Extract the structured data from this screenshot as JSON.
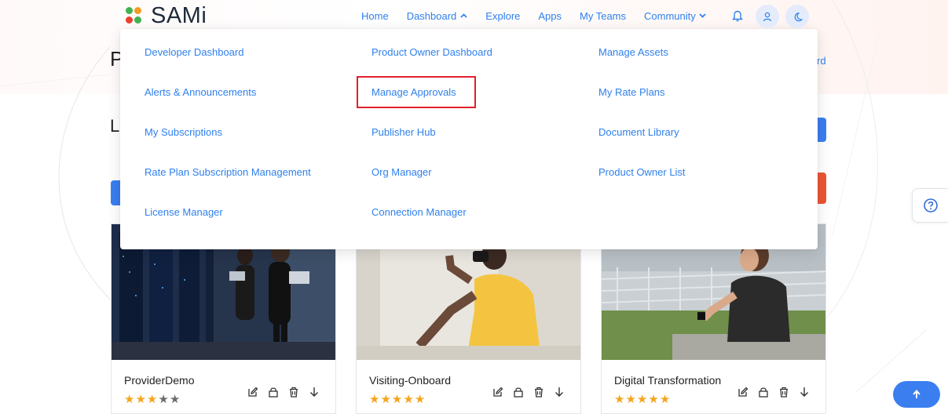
{
  "brand": {
    "name": "SAMi",
    "colors": {
      "green": "#3fb34f",
      "orange": "#f39a22",
      "red": "#e8412f",
      "blue": "#2f80ed"
    }
  },
  "nav": {
    "items": [
      {
        "label": "Home"
      },
      {
        "label": "Dashboard",
        "chevron": "up",
        "active": true
      },
      {
        "label": "Explore"
      },
      {
        "label": "Apps"
      },
      {
        "label": "My Teams"
      },
      {
        "label": "Community",
        "chevron": "down"
      }
    ],
    "icons": [
      "bell-icon",
      "user-icon",
      "moon-icon"
    ]
  },
  "dropdown": {
    "columns": [
      [
        "Developer Dashboard",
        "Alerts & Announcements",
        "My Subscriptions",
        "Rate Plan Subscription Management",
        "License Manager"
      ],
      [
        "Product Owner Dashboard",
        "Manage Approvals",
        "Publisher Hub",
        "Org Manager",
        "Connection Manager"
      ],
      [
        "Manage Assets",
        "My Rate Plans",
        "Document Library",
        "Product Owner List"
      ]
    ],
    "highlighted": "Manage Approvals",
    "highlight_color": "#e0202b"
  },
  "page": {
    "heading_partial": "P",
    "subheading_partial": "L",
    "link_partial": "rd"
  },
  "cards": [
    {
      "title": "ProviderDemo",
      "rating": 3,
      "max_rating": 5
    },
    {
      "title": "Visiting-Onboard",
      "rating": 5,
      "max_rating": 5
    },
    {
      "title": "Digital Transformation",
      "rating": 5,
      "max_rating": 5
    }
  ],
  "card_action_icons": [
    "edit-icon",
    "lock-icon",
    "trash-icon",
    "arrow-down-icon"
  ],
  "floating": {
    "help_icon": "question-circle-icon",
    "scroll_top_icon": "arrow-up-icon"
  }
}
